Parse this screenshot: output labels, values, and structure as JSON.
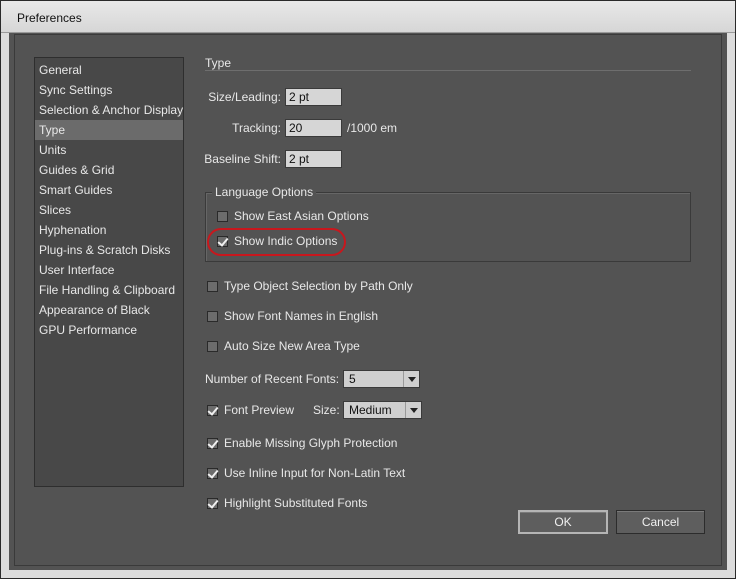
{
  "window": {
    "title": "Preferences"
  },
  "sidebar": {
    "items": [
      {
        "label": "General"
      },
      {
        "label": "Sync Settings"
      },
      {
        "label": "Selection & Anchor Display"
      },
      {
        "label": "Type",
        "selected": true
      },
      {
        "label": "Units"
      },
      {
        "label": "Guides & Grid"
      },
      {
        "label": "Smart Guides"
      },
      {
        "label": "Slices"
      },
      {
        "label": "Hyphenation"
      },
      {
        "label": "Plug-ins & Scratch Disks"
      },
      {
        "label": "User Interface"
      },
      {
        "label": "File Handling & Clipboard"
      },
      {
        "label": "Appearance of Black"
      },
      {
        "label": "GPU Performance"
      }
    ]
  },
  "type_panel": {
    "section_title": "Type",
    "size_leading": {
      "label": "Size/Leading:",
      "value": "2 pt"
    },
    "tracking": {
      "label": "Tracking:",
      "value": "20",
      "unit": "/1000 em"
    },
    "baseline_shift": {
      "label": "Baseline Shift:",
      "value": "2 pt"
    },
    "language_options": {
      "title": "Language Options",
      "show_east_asian": {
        "label": "Show East Asian Options",
        "checked": false
      },
      "show_indic": {
        "label": "Show Indic Options",
        "checked": true
      }
    },
    "type_object_selection": {
      "label": "Type Object Selection by Path Only",
      "checked": false
    },
    "show_font_names_english": {
      "label": "Show Font Names in English",
      "checked": false
    },
    "auto_size_area_type": {
      "label": "Auto Size New Area Type",
      "checked": false
    },
    "recent_fonts": {
      "label": "Number of Recent Fonts:",
      "value": "5"
    },
    "font_preview": {
      "label": "Font Preview",
      "checked": true,
      "size_label": "Size:",
      "size_value": "Medium"
    },
    "missing_glyph": {
      "label": "Enable Missing Glyph Protection",
      "checked": true
    },
    "inline_input": {
      "label": "Use Inline Input for Non-Latin Text",
      "checked": true
    },
    "highlight_substituted": {
      "label": "Highlight Substituted Fonts",
      "checked": true
    }
  },
  "buttons": {
    "ok": "OK",
    "cancel": "Cancel"
  },
  "colors": {
    "panel": "#535353",
    "highlight_ring": "#c8171d",
    "selected_item": "#6b6b6b"
  }
}
